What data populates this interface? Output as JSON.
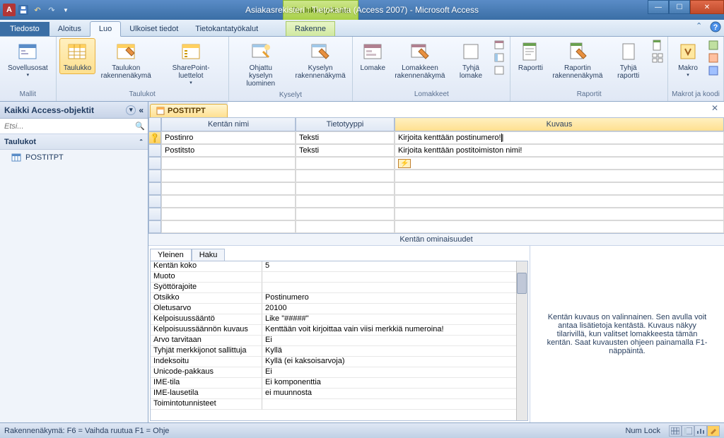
{
  "titlebar": {
    "context_tool_label": "Taulukkotyökalut",
    "title": "Asiakasrekisteri : Tietokanta (Access 2007)  -  Microsoft Access"
  },
  "tabs": {
    "file": "Tiedosto",
    "home": "Aloitus",
    "create": "Luo",
    "external": "Ulkoiset tiedot",
    "dbtools": "Tietokantatyökalut",
    "design": "Rakenne"
  },
  "ribbon": {
    "groups": {
      "templates": "Mallit",
      "tables": "Taulukot",
      "queries": "Kyselyt",
      "forms": "Lomakkeet",
      "reports": "Raportit",
      "macros": "Makrot ja koodi"
    },
    "app_parts": "Sovellusosat",
    "table": "Taulukko",
    "table_design": "Taulukon rakennenäkymä",
    "sharepoint": "SharePoint-luettelot",
    "query_wizard": "Ohjattu kyselyn luominen",
    "query_design": "Kyselyn rakennenäkymä",
    "form": "Lomake",
    "form_design": "Lomakkeen rakennenäkymä",
    "blank_form": "Tyhjä lomake",
    "report": "Raportti",
    "report_design": "Raportin rakennenäkymä",
    "blank_report": "Tyhjä raportti",
    "macro": "Makro"
  },
  "navpane": {
    "header": "Kaikki Access-objektit",
    "search_placeholder": "Etsi...",
    "group_tables": "Taulukot",
    "items": [
      "POSTITPT"
    ]
  },
  "design": {
    "tab_name": "POSTITPT",
    "columns": {
      "name": "Kentän nimi",
      "type": "Tietotyyppi",
      "desc": "Kuvaus"
    },
    "rows": [
      {
        "pk": true,
        "name": "Postinro",
        "type": "Teksti",
        "desc": "Kirjoita kenttään postinumero!",
        "editing": true
      },
      {
        "pk": false,
        "name": "Postitsto",
        "type": "Teksti",
        "desc": "Kirjoita kenttään postitoimiston nimi!"
      }
    ],
    "prop_header": "Kentän ominaisuudet",
    "prop_tabs": {
      "general": "Yleinen",
      "lookup": "Haku"
    },
    "properties": [
      {
        "name": "Kentän koko",
        "value": "5"
      },
      {
        "name": "Muoto",
        "value": ""
      },
      {
        "name": "Syöttörajoite",
        "value": ""
      },
      {
        "name": "Otsikko",
        "value": "Postinumero"
      },
      {
        "name": "Oletusarvo",
        "value": "20100"
      },
      {
        "name": "Kelpoisuussääntö",
        "value": "Like \"#####\""
      },
      {
        "name": "Kelpoisuussäännön kuvaus",
        "value": "Kenttään voit kirjoittaa vain viisi merkkiä numeroina!"
      },
      {
        "name": "Arvo tarvitaan",
        "value": "Ei"
      },
      {
        "name": "Tyhjät merkkijonot sallittuja",
        "value": "Kyllä"
      },
      {
        "name": "Indeksoitu",
        "value": "Kyllä (ei kaksoisarvoja)"
      },
      {
        "name": "Unicode-pakkaus",
        "value": "Ei"
      },
      {
        "name": "IME-tila",
        "value": "Ei komponenttia"
      },
      {
        "name": "IME-lausetila",
        "value": "ei muunnosta"
      },
      {
        "name": "Toimintotunnisteet",
        "value": ""
      }
    ],
    "help_text": "Kentän kuvaus on valinnainen. Sen avulla voit antaa lisätietoja kentästä. Kuvaus näkyy tilarivillä, kun valitset lomakkeesta tämän kentän. Saat kuvausten ohjeen painamalla F1-näppäintä."
  },
  "statusbar": {
    "left": "Rakennenäkymä: F6 = Vaihda ruutua  F1 = Ohje",
    "numlock": "Num Lock"
  }
}
